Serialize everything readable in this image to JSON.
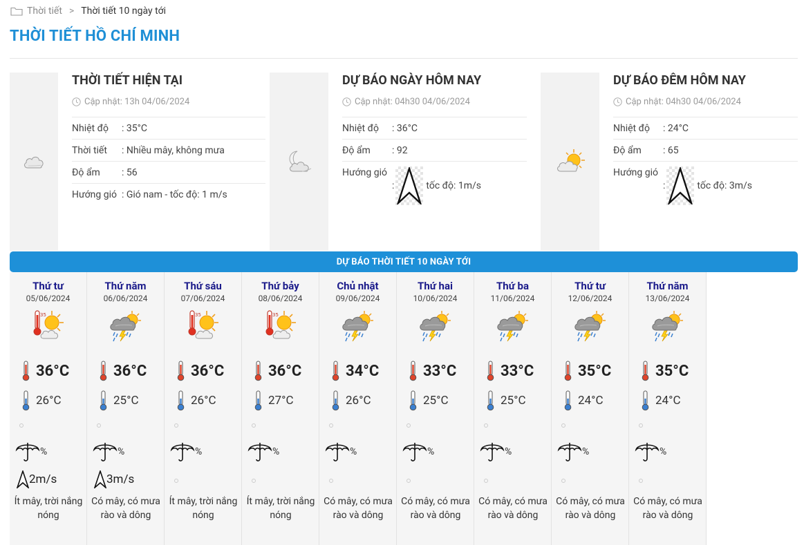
{
  "breadcrumb": {
    "home": "Thời tiết",
    "separator": ">",
    "current": "Thời tiết 10 ngày tới"
  },
  "page_title": "THỜI TIẾT HỒ CHÍ MINH",
  "current": {
    "title": "THỜI TIẾT HIỆN TẠI",
    "updated": "Cập nhật: 13h 04/06/2024",
    "rows": [
      {
        "label": "Nhiệt độ",
        "value": ": 35°C"
      },
      {
        "label": "Thời tiết",
        "value": ": Nhiều mây, không mưa"
      },
      {
        "label": "Độ ẩm",
        "value": ": 56"
      },
      {
        "label": "Hướng gió",
        "value": ": Gió nam - tốc độ: 1 m/s"
      }
    ],
    "icon": "cloudy-icon"
  },
  "today": {
    "title": "DỰ BÁO NGÀY HÔM NAY",
    "updated": "Cập nhật: 04h30 04/06/2024",
    "temp_label": "Nhiệt độ",
    "temp_value": ": 36°C",
    "humidity_label": "Độ ẩm",
    "humidity_value": ": 92",
    "wind_label": "Hướng gió",
    "wind_prefix": ":",
    "wind_speed": "tốc độ: 1m/s",
    "icon": "moon-cloud-icon"
  },
  "tonight": {
    "title": "DỰ BÁO ĐÊM HÔM NAY",
    "updated": "Cập nhật: 04h30 04/06/2024",
    "temp_label": "Nhiệt độ",
    "temp_value": ": 24°C",
    "humidity_label": "Độ ẩm",
    "humidity_value": ": 65",
    "wind_label": "Hướng gió",
    "wind_prefix": ":",
    "wind_speed": "tốc độ: 3m/s",
    "icon": "sun-cloud-icon"
  },
  "banner": "DỰ BÁO THỜI TIẾT 10 NGÀY TỚI",
  "days": [
    {
      "name": "Thứ tư",
      "date": "05/06/2024",
      "hi": "36°C",
      "lo": "26°C",
      "rain": "%",
      "wind": "2m/s",
      "desc": "Ít mây, trời nắng nóng",
      "icon": "hot-sun-icon"
    },
    {
      "name": "Thứ năm",
      "date": "06/06/2024",
      "hi": "36°C",
      "lo": "25°C",
      "rain": "%",
      "wind": "3m/s",
      "desc": "Có mây, có mưa rào và dông",
      "icon": "thunderstorm-icon"
    },
    {
      "name": "Thứ sáu",
      "date": "07/06/2024",
      "hi": "36°C",
      "lo": "26°C",
      "rain": "%",
      "wind": "",
      "desc": "Ít mây, trời nắng nóng",
      "icon": "hot-sun-icon"
    },
    {
      "name": "Thứ bảy",
      "date": "08/06/2024",
      "hi": "36°C",
      "lo": "27°C",
      "rain": "%",
      "wind": "",
      "desc": "Ít mây, trời nắng nóng",
      "icon": "hot-sun-icon"
    },
    {
      "name": "Chủ nhật",
      "date": "09/06/2024",
      "hi": "34°C",
      "lo": "26°C",
      "rain": "%",
      "wind": "",
      "desc": "Có mây, có mưa rào và dông",
      "icon": "thunderstorm-icon"
    },
    {
      "name": "Thứ hai",
      "date": "10/06/2024",
      "hi": "33°C",
      "lo": "25°C",
      "rain": "%",
      "wind": "",
      "desc": "Có mây, có mưa rào và dông",
      "icon": "thunderstorm-icon"
    },
    {
      "name": "Thứ ba",
      "date": "11/06/2024",
      "hi": "33°C",
      "lo": "25°C",
      "rain": "%",
      "wind": "",
      "desc": "Có mây, có mưa rào và dông",
      "icon": "thunderstorm-icon"
    },
    {
      "name": "Thứ tư",
      "date": "12/06/2024",
      "hi": "35°C",
      "lo": "24°C",
      "rain": "%",
      "wind": "",
      "desc": "Có mây, có mưa rào và dông",
      "icon": "thunderstorm-icon"
    },
    {
      "name": "Thứ năm",
      "date": "13/06/2024",
      "hi": "35°C",
      "lo": "24°C",
      "rain": "%",
      "wind": "",
      "desc": "Có mây, có mưa rào và dông",
      "icon": "thunderstorm-icon"
    }
  ],
  "colors": {
    "accent": "#1e8fd6",
    "banner": "#1e90d8",
    "day_name": "#1a1a8a",
    "panel_bg": "#f5f5f5"
  }
}
